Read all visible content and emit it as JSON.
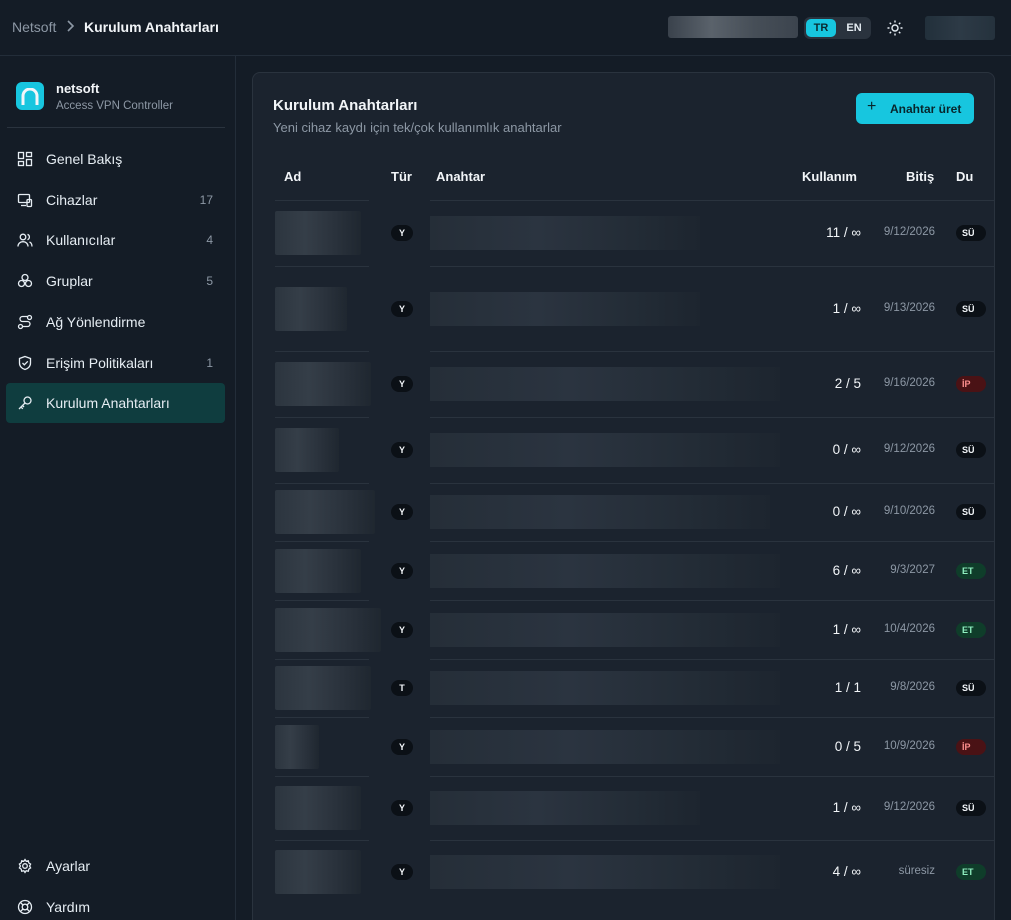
{
  "breadcrumb": {
    "root": "Netsoft",
    "current": "Kurulum Anahtarları"
  },
  "lang": {
    "tr": "TR",
    "en": "EN"
  },
  "brand": {
    "name": "netsoft",
    "subtitle": "Access VPN Controller"
  },
  "nav": [
    {
      "label": "Genel Bakış",
      "count": "",
      "icon": "dashboard-icon"
    },
    {
      "label": "Cihazlar",
      "count": "17",
      "icon": "devices-icon"
    },
    {
      "label": "Kullanıcılar",
      "count": "4",
      "icon": "users-icon"
    },
    {
      "label": "Gruplar",
      "count": "5",
      "icon": "groups-icon"
    },
    {
      "label": "Ağ Yönlendirme",
      "count": "",
      "icon": "route-icon"
    },
    {
      "label": "Erişim Politikaları",
      "count": "1",
      "icon": "shield-icon"
    },
    {
      "label": "Kurulum Anahtarları",
      "count": "",
      "icon": "key-icon"
    }
  ],
  "footer_nav": [
    {
      "label": "Ayarlar",
      "icon": "gear-icon"
    },
    {
      "label": "Yardım",
      "icon": "help-icon"
    }
  ],
  "page": {
    "title": "Kurulum Anahtarları",
    "subtitle": "Yeni cihaz kaydı için tek/çok kullanımlık anahtarlar",
    "generate_label": "Anahtar üret"
  },
  "table": {
    "headers": {
      "name": "Ad",
      "type": "Tür",
      "key": "Anahtar",
      "usage": "Kullanım",
      "expiry": "Bitiş",
      "status": "Du"
    },
    "rows": [
      {
        "type": "Y",
        "usage": "11 / ∞",
        "expiry": "9/12/2026",
        "status": "SÜ",
        "tone": "dark"
      },
      {
        "type": "Y",
        "usage": "1 / ∞",
        "expiry": "9/13/2026",
        "status": "SÜ",
        "tone": "dark"
      },
      {
        "type": "Y",
        "usage": "2 / 5",
        "expiry": "9/16/2026",
        "status": "İP",
        "tone": "red"
      },
      {
        "type": "Y",
        "usage": "0 / ∞",
        "expiry": "9/12/2026",
        "status": "SÜ",
        "tone": "dark"
      },
      {
        "type": "Y",
        "usage": "0 / ∞",
        "expiry": "9/10/2026",
        "status": "SÜ",
        "tone": "dark"
      },
      {
        "type": "Y",
        "usage": "6 / ∞",
        "expiry": "9/3/2027",
        "status": "ET",
        "tone": "green"
      },
      {
        "type": "Y",
        "usage": "1 / ∞",
        "expiry": "10/4/2026",
        "status": "ET",
        "tone": "green"
      },
      {
        "type": "T",
        "usage": "1 / 1",
        "expiry": "9/8/2026",
        "status": "SÜ",
        "tone": "dark"
      },
      {
        "type": "Y",
        "usage": "0 / 5",
        "expiry": "10/9/2026",
        "status": "İP",
        "tone": "red"
      },
      {
        "type": "Y",
        "usage": "1 / ∞",
        "expiry": "9/12/2026",
        "status": "SÜ",
        "tone": "dark"
      },
      {
        "type": "Y",
        "usage": "4 / ∞",
        "expiry": "süresiz",
        "status": "ET",
        "tone": "green"
      }
    ]
  },
  "colors": {
    "accent": "#17c6df",
    "active_nav": "#0f3d3f",
    "status_red": "#4a1215",
    "status_green": "#0f3d2a"
  }
}
